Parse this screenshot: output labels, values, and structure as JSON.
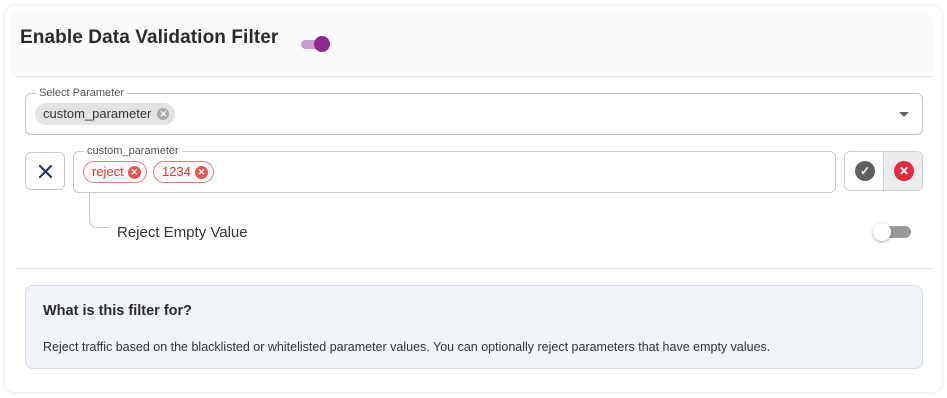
{
  "header": {
    "title": "Enable Data Validation Filter",
    "filter_enabled": true
  },
  "select_parameter": {
    "legend": "Select Parameter",
    "selected": [
      "custom_parameter"
    ],
    "remove_icon": "circle-x-icon",
    "dropdown_icon": "caret-down-icon"
  },
  "parameter_values": {
    "legend": "custom_parameter",
    "values": [
      "reject",
      "1234"
    ],
    "remove_icon": "circle-x-icon",
    "delete_row_icon": "x-icon",
    "confirm_icon": "check-circle-icon",
    "cancel_icon": "x-circle-icon"
  },
  "reject_empty": {
    "label": "Reject Empty Value",
    "enabled": false
  },
  "info": {
    "title": "What is this filter for?",
    "text": "Reject traffic based on the blacklisted or whitelisted parameter values. You can optionally reject parameters that have empty values."
  },
  "colors": {
    "accent": "#8b2a8e",
    "accent_track": "#c79bcf",
    "danger": "#e05858",
    "chip_danger_text": "#d43c3c",
    "confirm": "#5f5f5f",
    "remove_icon": "#1f3a5f",
    "info_bg": "#f1f4f8"
  }
}
